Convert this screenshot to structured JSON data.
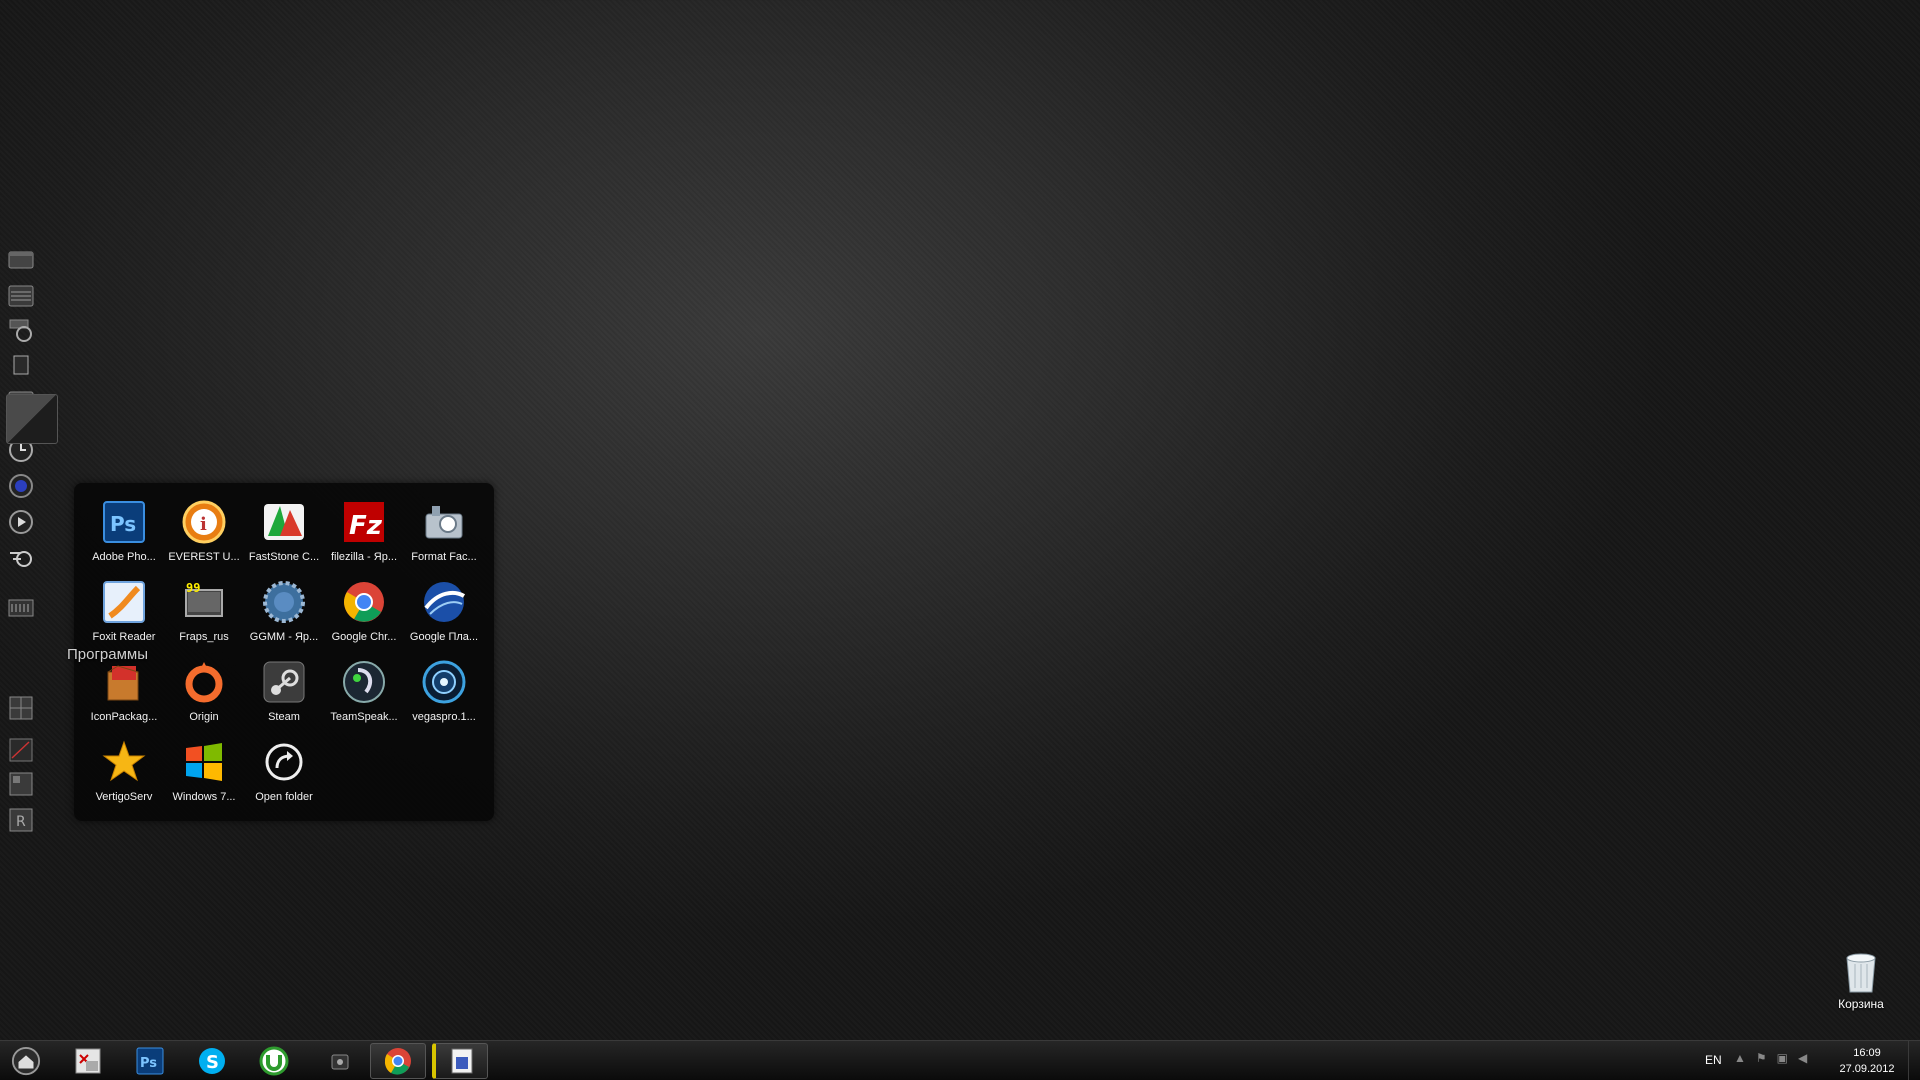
{
  "desktop": {
    "dock_label": "Программы",
    "folder": {
      "apps": [
        {
          "label": "Adobe Pho...",
          "icon": "photoshop-icon"
        },
        {
          "label": "EVEREST U...",
          "icon": "everest-icon"
        },
        {
          "label": "FastStone C...",
          "icon": "faststone-icon"
        },
        {
          "label": "filezilla - Яр...",
          "icon": "filezilla-icon"
        },
        {
          "label": "Format Fac...",
          "icon": "format-factory-icon"
        },
        {
          "label": "Foxit Reader",
          "icon": "foxit-icon"
        },
        {
          "label": "Fraps_rus",
          "icon": "fraps-icon"
        },
        {
          "label": "GGMM - Яр...",
          "icon": "ggmm-icon"
        },
        {
          "label": "Google Chr...",
          "icon": "chrome-icon"
        },
        {
          "label": "Google Пла...",
          "icon": "google-earth-icon"
        },
        {
          "label": "IconPackag...",
          "icon": "iconpackager-icon"
        },
        {
          "label": "Origin",
          "icon": "origin-icon"
        },
        {
          "label": "Steam",
          "icon": "steam-icon"
        },
        {
          "label": "TeamSpeak...",
          "icon": "teamspeak-icon"
        },
        {
          "label": "vegaspro.1...",
          "icon": "vegas-icon"
        },
        {
          "label": "VertigoServ",
          "icon": "vertigo-icon"
        },
        {
          "label": "Windows 7...",
          "icon": "windows-icon"
        },
        {
          "label": "Open folder",
          "icon": "open-folder-icon"
        }
      ]
    },
    "recycle_bin": {
      "label": "Корзина",
      "icon": "recycle-bin-icon"
    }
  },
  "taskbar": {
    "language": "EN",
    "clock": {
      "time": "16:09",
      "date": "27.09.2012"
    },
    "apps": [
      "home-icon",
      "document-icon",
      "photoshop-icon",
      "skype-icon",
      "utorrent-icon",
      "camera-icon",
      "chrome-icon",
      "media-file-icon"
    ]
  },
  "colors": {
    "background": "#2a2a2a",
    "folder_bg": "#080808",
    "taskbar": "#111111"
  }
}
